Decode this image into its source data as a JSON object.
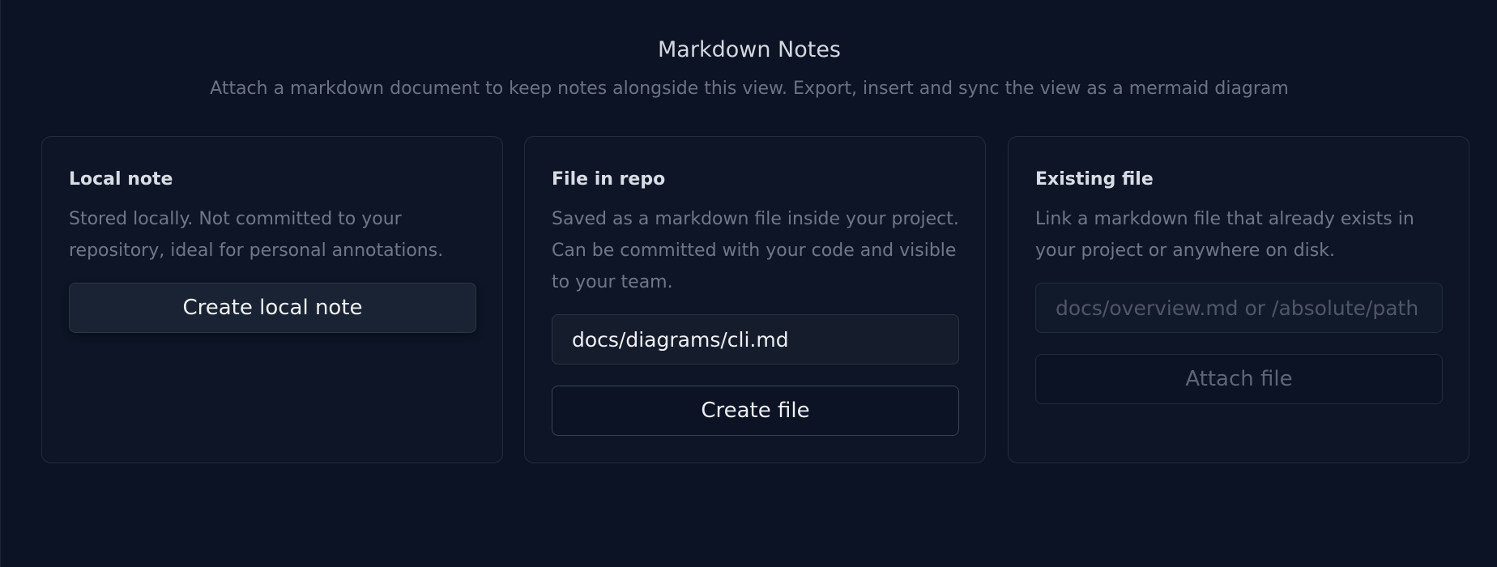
{
  "header": {
    "title": "Markdown Notes",
    "subtitle": "Attach a markdown document to keep notes alongside this view. Export, insert and sync the view as a mermaid diagram"
  },
  "cards": {
    "local": {
      "title": "Local note",
      "description": "Stored locally. Not committed to your repository, ideal for personal annotations.",
      "button_label": "Create local note"
    },
    "repo": {
      "title": "File in repo",
      "description": "Saved as a markdown file inside your project. Can be committed with your code and visible to your team.",
      "path_value": "docs/diagrams/cli.md",
      "button_label": "Create file"
    },
    "existing": {
      "title": "Existing file",
      "description": "Link a markdown file that already exists in your project or anywhere on disk.",
      "path_placeholder": "docs/overview.md or /absolute/path",
      "button_label": "Attach file"
    }
  },
  "colors": {
    "background": "#0b1324",
    "card_border": "#232c3d",
    "text_primary": "#d8dce4",
    "text_muted": "#6f7788"
  }
}
